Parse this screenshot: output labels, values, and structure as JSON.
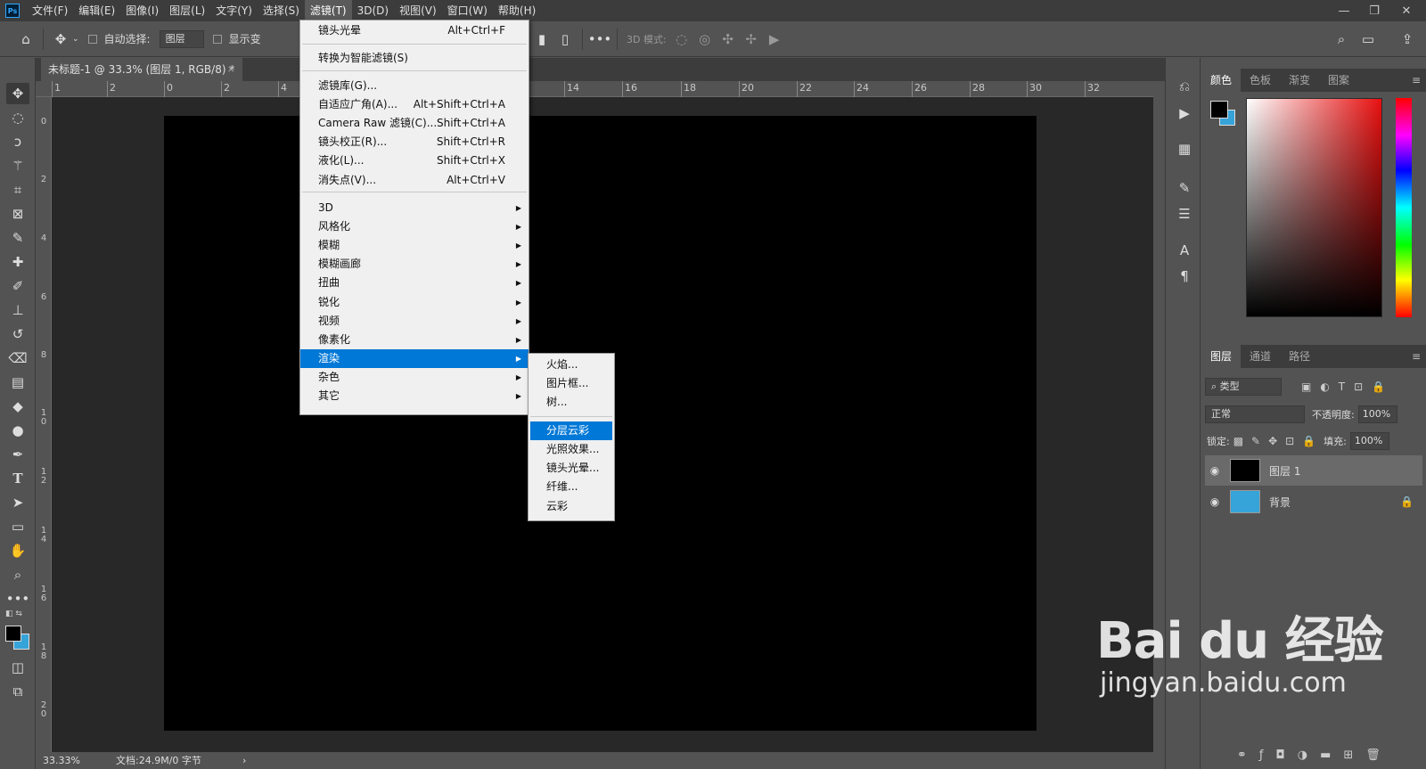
{
  "menubar": {
    "logo": "Ps",
    "items": [
      "文件(F)",
      "编辑(E)",
      "图像(I)",
      "图层(L)",
      "文字(Y)",
      "选择(S)",
      "滤镜(T)",
      "3D(D)",
      "视图(V)",
      "窗口(W)",
      "帮助(H)"
    ],
    "active_index": 6
  },
  "options": {
    "auto_select_label": "自动选择:",
    "auto_select_value": "图层",
    "show_transform_label": "显示变",
    "mode_3d_label": "3D 模式:"
  },
  "document": {
    "tab_title": "未标题-1 @ 33.3% (图层 1, RGB/8) *",
    "close_glyph": "×",
    "canvas_color": "#000000"
  },
  "rulers": {
    "top": [
      "1",
      "2",
      "0",
      "2",
      "4",
      "14",
      "16",
      "18",
      "20",
      "22",
      "24",
      "26",
      "28",
      "30",
      "32"
    ],
    "left": [
      "0",
      "2",
      "4",
      "6",
      "8",
      "1 0",
      "1 2",
      "1 4",
      "1 6",
      "1 8",
      "2 0"
    ]
  },
  "status": {
    "zoom": "33.33%",
    "doc_info": "文档:24.9M/0 字节",
    "arrow": "›"
  },
  "filter_menu": {
    "items": [
      {
        "label": "镜头光晕",
        "shortcut": "Alt+Ctrl+F"
      },
      {
        "label": "转换为智能滤镜(S)",
        "shortcut": ""
      },
      {
        "label": "滤镜库(G)...",
        "shortcut": ""
      },
      {
        "label": "自适应广角(A)...",
        "shortcut": "Alt+Shift+Ctrl+A"
      },
      {
        "label": "Camera Raw 滤镜(C)...",
        "shortcut": "Shift+Ctrl+A"
      },
      {
        "label": "镜头校正(R)...",
        "shortcut": "Shift+Ctrl+R"
      },
      {
        "label": "液化(L)...",
        "shortcut": "Shift+Ctrl+X"
      },
      {
        "label": "消失点(V)...",
        "shortcut": "Alt+Ctrl+V"
      },
      {
        "label": "3D",
        "shortcut": ""
      },
      {
        "label": "风格化",
        "shortcut": ""
      },
      {
        "label": "模糊",
        "shortcut": ""
      },
      {
        "label": "模糊画廊",
        "shortcut": ""
      },
      {
        "label": "扭曲",
        "shortcut": ""
      },
      {
        "label": "锐化",
        "shortcut": ""
      },
      {
        "label": "视频",
        "shortcut": ""
      },
      {
        "label": "像素化",
        "shortcut": ""
      },
      {
        "label": "渲染",
        "shortcut": ""
      },
      {
        "label": "杂色",
        "shortcut": ""
      },
      {
        "label": "其它",
        "shortcut": ""
      }
    ],
    "highlighted": "渲染",
    "arrow_glyph": "▶"
  },
  "render_submenu": {
    "items": [
      "火焰...",
      "图片框...",
      "树...",
      "分层云彩",
      "光照效果...",
      "镜头光晕...",
      "纤维...",
      "云彩"
    ],
    "highlighted": "分层云彩"
  },
  "color_panel": {
    "tabs": [
      "颜色",
      "色板",
      "渐变",
      "图案"
    ],
    "active_tab": "颜色",
    "foreground": "#000000",
    "background": "#36a3d9"
  },
  "layers_panel": {
    "tabs": [
      "图层",
      "通道",
      "路径"
    ],
    "active_tab": "图层",
    "filter_label": "类型",
    "blend_mode": "正常",
    "opacity_label": "不透明度:",
    "opacity_value": "100%",
    "lock_label": "锁定:",
    "fill_label": "填充:",
    "fill_value": "100%",
    "layers": [
      {
        "name": "图层 1",
        "color": "#000000",
        "selected": true,
        "locked": false
      },
      {
        "name": "背景",
        "color": "#36a3d9",
        "selected": false,
        "locked": true
      }
    ]
  },
  "watermark": {
    "brand": "Bai du 经验",
    "url": "jingyan.baidu.com"
  }
}
